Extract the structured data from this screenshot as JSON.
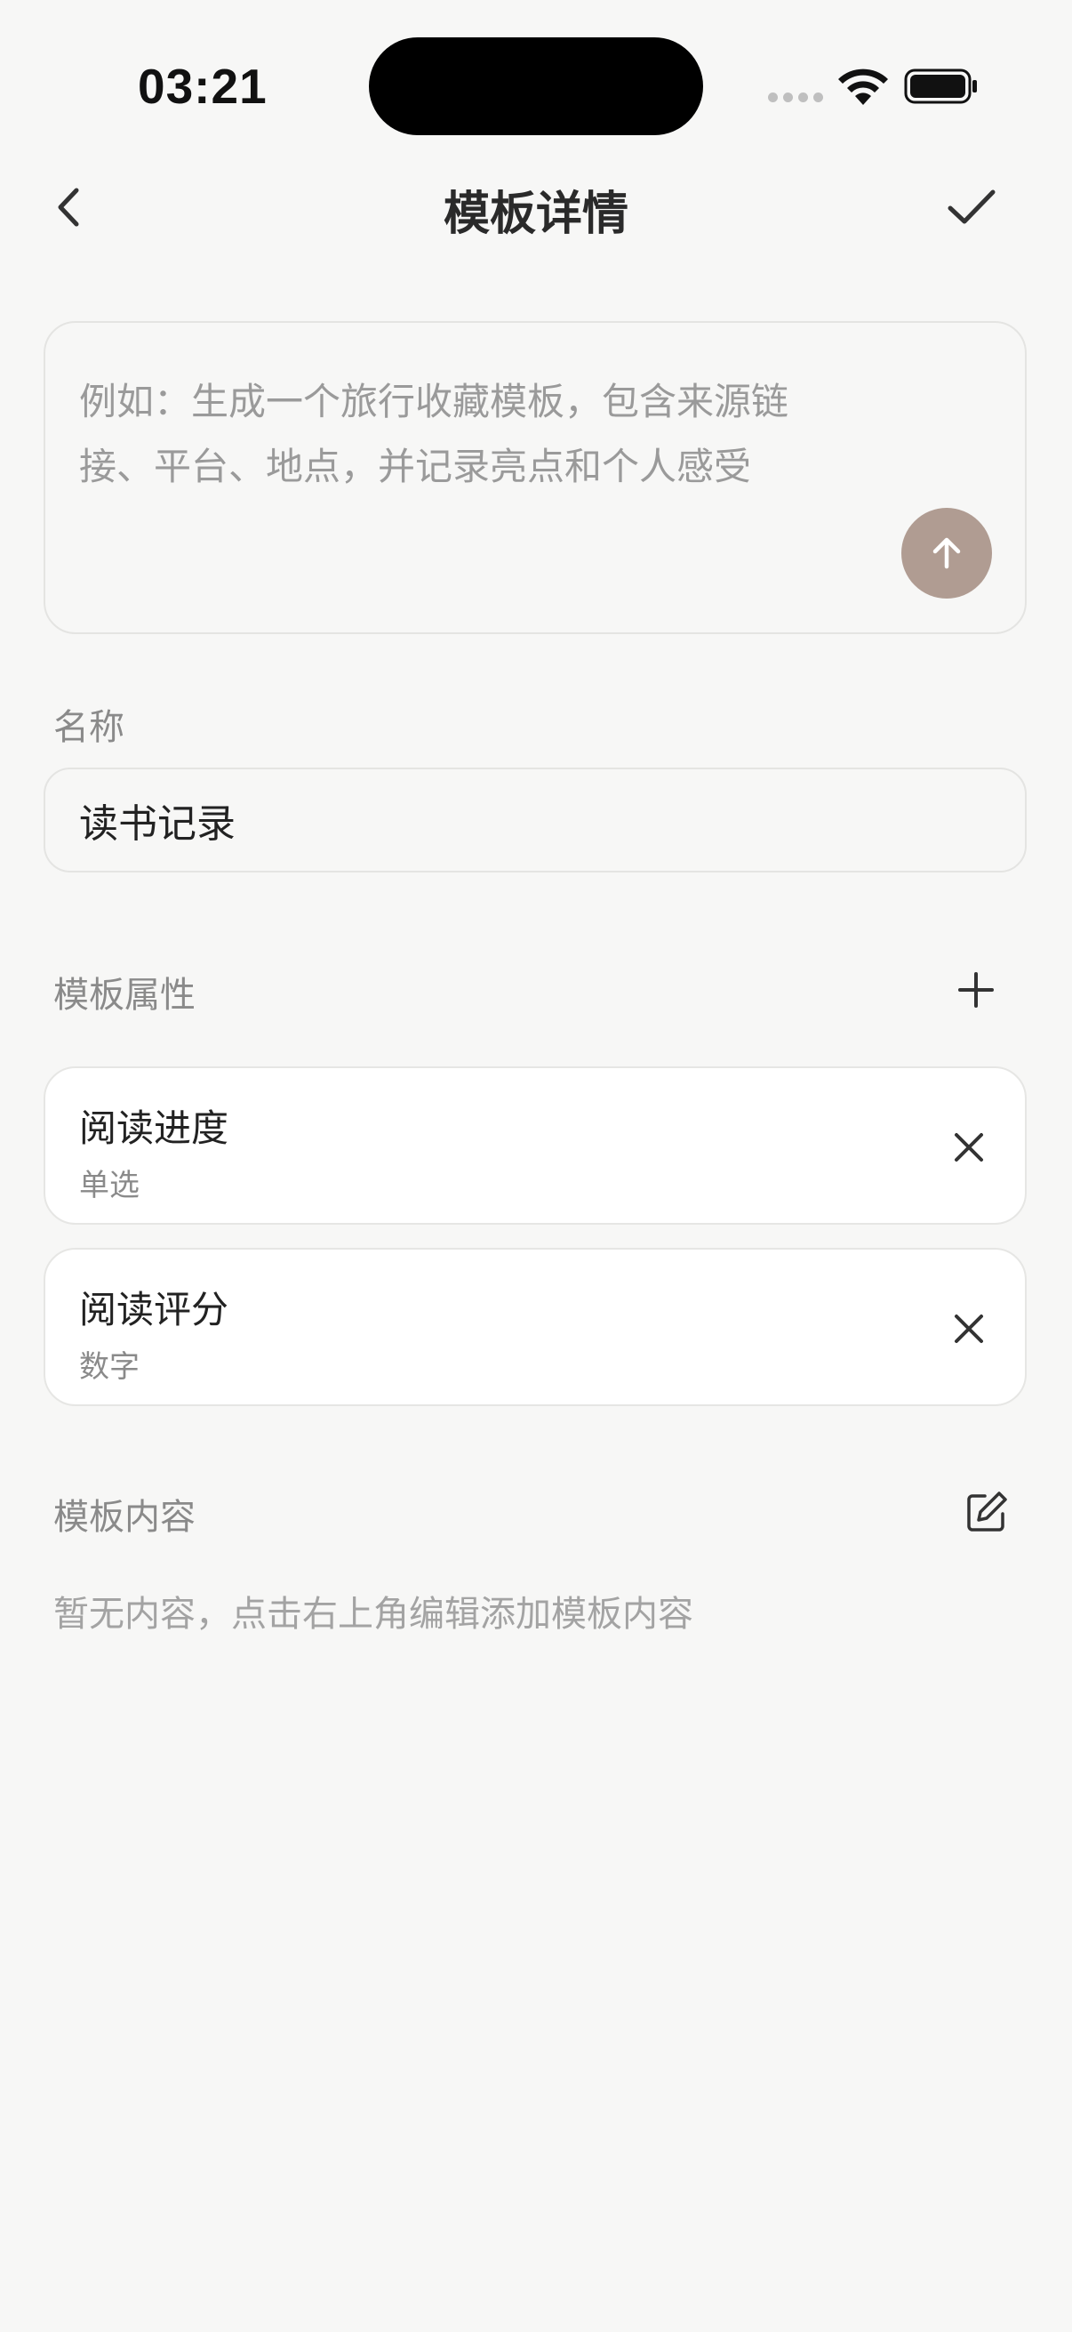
{
  "status_bar": {
    "time": "03:21",
    "icons": [
      "cellular-signal-icon",
      "wifi-icon",
      "battery-icon"
    ]
  },
  "nav": {
    "title": "模板详情",
    "back_icon": "chevron-left-icon",
    "confirm_icon": "checkmark-icon"
  },
  "prompt": {
    "placeholder_line1": "例如：生成一个旅行收藏模板，包含来源链",
    "placeholder_line2": "接、平台、地点，并记录亮点和个人感受",
    "send_icon": "arrow-up-icon",
    "send_color": "#b09c92"
  },
  "name_section": {
    "label": "名称",
    "value": "读书记录"
  },
  "attributes_section": {
    "label": "模板属性",
    "add_icon": "plus-icon",
    "items": [
      {
        "name": "阅读进度",
        "type": "单选"
      },
      {
        "name": "阅读评分",
        "type": "数字"
      }
    ]
  },
  "content_section": {
    "label": "模板内容",
    "edit_icon": "edit-icon",
    "empty_hint": "暂无内容，点击右上角编辑添加模板内容"
  }
}
